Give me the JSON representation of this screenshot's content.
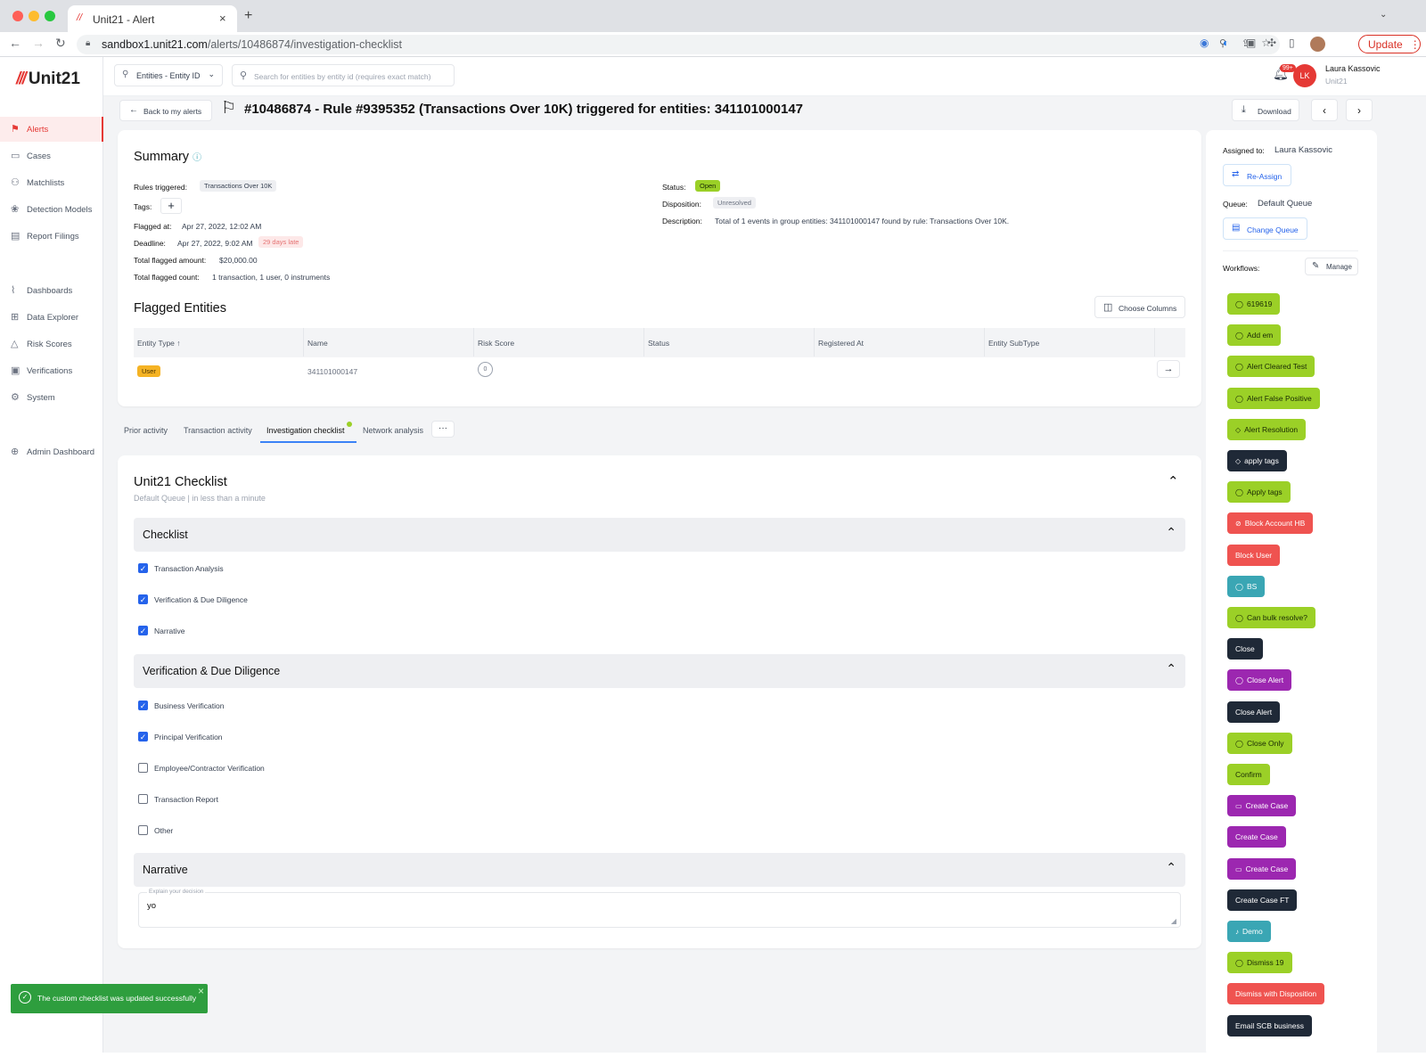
{
  "browser": {
    "tab_title": "Unit21 - Alert",
    "url_host": "sandbox1.unit21.com",
    "url_path": "/alerts/10486874/investigation-checklist",
    "update_label": "Update"
  },
  "app": {
    "logo": "Unit21",
    "entity_select": "Entities - Entity ID",
    "search_placeholder": "Search for entities by entity id (requires exact match)",
    "notif_count": "99+",
    "user_initials": "LK",
    "user_name": "Laura Kassovic",
    "user_org": "Unit21"
  },
  "sidebar": {
    "items": [
      {
        "label": "Alerts",
        "icon": "flag-icon"
      },
      {
        "label": "Cases",
        "icon": "briefcase-icon"
      },
      {
        "label": "Matchlists",
        "icon": "user-plus-icon"
      },
      {
        "label": "Detection Models",
        "icon": "brain-icon"
      },
      {
        "label": "Report Filings",
        "icon": "report-icon"
      },
      {
        "label": "Dashboards",
        "icon": "chart-icon"
      },
      {
        "label": "Data Explorer",
        "icon": "table-search-icon"
      },
      {
        "label": "Risk Scores",
        "icon": "warning-icon"
      },
      {
        "label": "Verifications",
        "icon": "id-card-icon"
      },
      {
        "label": "System",
        "icon": "gear-icon"
      },
      {
        "label": "Admin Dashboard",
        "icon": "globe-icon"
      }
    ]
  },
  "header": {
    "back_label": "Back to my alerts",
    "title": "#10486874 - Rule #9395352 (Transactions Over 10K) triggered for entities: 341101000147",
    "download_label": "Download"
  },
  "summary": {
    "title": "Summary",
    "rules_triggered_label": "Rules triggered:",
    "rules_triggered": "Transactions Over 10K",
    "tags_label": "Tags:",
    "flagged_at_label": "Flagged at:",
    "flagged_at": "Apr 27, 2022, 12:02 AM",
    "deadline_label": "Deadline:",
    "deadline": "Apr 27, 2022, 9:02 AM",
    "late_badge": "29 days late",
    "total_amount_label": "Total flagged amount:",
    "total_amount": "$20,000.00",
    "total_count_label": "Total flagged count:",
    "total_count": "1 transaction, 1 user, 0 instruments",
    "status_label": "Status:",
    "status": "Open",
    "disposition_label": "Disposition:",
    "disposition": "Unresolved",
    "description_label": "Description:",
    "description": "Total of 1 events in group entities: 341101000147 found by rule: Transactions Over 10K."
  },
  "flagged": {
    "title": "Flagged Entities",
    "choose_columns": "Choose Columns",
    "columns": [
      "Entity Type",
      "Name",
      "Risk Score",
      "Status",
      "Registered At",
      "Entity SubType"
    ],
    "sort_arrow": "↑",
    "row": {
      "type": "User",
      "name": "341101000147",
      "risk": "0"
    }
  },
  "tabs": [
    {
      "label": "Prior activity"
    },
    {
      "label": "Transaction activity"
    },
    {
      "label": "Investigation checklist"
    },
    {
      "label": "Network analysis"
    }
  ],
  "tabs_more": "···",
  "checklist": {
    "title": "Unit21 Checklist",
    "subtitle": "Default Queue | in less than a minute",
    "sections": [
      {
        "title": "Checklist",
        "items": [
          {
            "label": "Transaction Analysis",
            "checked": true
          },
          {
            "label": "Verification & Due Diligence",
            "checked": true
          },
          {
            "label": "Narrative",
            "checked": true
          }
        ]
      },
      {
        "title": "Verification & Due Diligence",
        "items": [
          {
            "label": "Business Verification",
            "checked": true
          },
          {
            "label": "Principal Verification",
            "checked": true
          },
          {
            "label": "Employee/Contractor Verification",
            "checked": false
          },
          {
            "label": "Transaction Report",
            "checked": false
          },
          {
            "label": "Other",
            "checked": false
          }
        ]
      },
      {
        "title": "Narrative"
      }
    ],
    "narrative_label": "Explain your decision",
    "narrative_value": "yo"
  },
  "right_panel": {
    "assigned_label": "Assigned to:",
    "assigned_value": "Laura Kassovic",
    "reassign_label": "Re-Assign",
    "queue_label": "Queue:",
    "queue_value": "Default Queue",
    "change_queue_label": "Change Queue",
    "workflows_label": "Workflows:",
    "manage_label": "Manage",
    "workflows": [
      {
        "label": "619619",
        "color": "lime",
        "icon": "check-circle-icon"
      },
      {
        "label": "Add em",
        "color": "lime",
        "icon": "check-circle-icon"
      },
      {
        "label": "Alert Cleared Test",
        "color": "lime",
        "icon": "check-circle-icon"
      },
      {
        "label": "Alert False Positive",
        "color": "lime",
        "icon": "check-circle-icon"
      },
      {
        "label": "Alert Resolution",
        "color": "lime",
        "icon": "tag-icon"
      },
      {
        "label": "apply tags",
        "color": "dark",
        "icon": "tag-icon"
      },
      {
        "label": "Apply tags",
        "color": "lime",
        "icon": "check-circle-icon"
      },
      {
        "label": "Block Account HB",
        "color": "red",
        "icon": "block-icon"
      },
      {
        "label": "Block User",
        "color": "red",
        "icon": ""
      },
      {
        "label": "BS",
        "color": "teal",
        "icon": "check-circle-icon"
      },
      {
        "label": "Can bulk resolve?",
        "color": "lime",
        "icon": "check-circle-icon"
      },
      {
        "label": "Close",
        "color": "dark",
        "icon": ""
      },
      {
        "label": "Close Alert",
        "color": "purple",
        "icon": "check-circle-icon"
      },
      {
        "label": "Close Alert",
        "color": "dark",
        "icon": ""
      },
      {
        "label": "Close Only",
        "color": "lime",
        "icon": "check-circle-icon"
      },
      {
        "label": "Confirm",
        "color": "lime",
        "icon": ""
      },
      {
        "label": "Create Case",
        "color": "purple",
        "icon": "briefcase-icon"
      },
      {
        "label": "Create Case",
        "color": "purple",
        "icon": ""
      },
      {
        "label": "Create Case",
        "color": "purple",
        "icon": "briefcase-icon"
      },
      {
        "label": "Create Case FT",
        "color": "dark",
        "icon": ""
      },
      {
        "label": "Demo",
        "color": "teal",
        "icon": "bell-icon"
      },
      {
        "label": "Dismiss 19",
        "color": "lime",
        "icon": "check-circle-icon"
      },
      {
        "label": "Dismiss with Disposition",
        "color": "red",
        "icon": ""
      },
      {
        "label": "Email SCB business",
        "color": "dark",
        "icon": ""
      }
    ]
  },
  "toast": {
    "message": "The custom checklist was updated successfully",
    "close": "×"
  },
  "colors": {
    "brand_red": "#e53935",
    "lime": "#9bd027",
    "dark": "#1f2937",
    "red": "#ef5350",
    "teal": "#3aa6b4",
    "purple": "#9c27b0",
    "toast_green": "#2e9e3e"
  }
}
